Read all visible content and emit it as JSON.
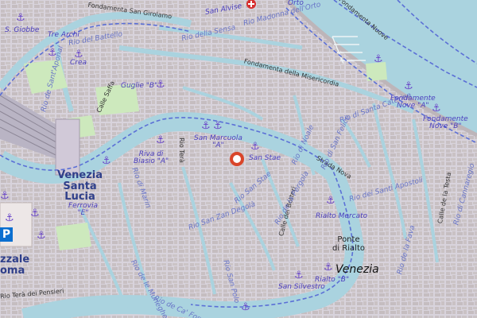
{
  "map": {
    "district": "Venezia",
    "poi": {
      "ponte_di_rialto": "Ponte\ndi Rialto"
    },
    "station": {
      "name": "Venezia\nSanta\nLucia",
      "sub": "Ferrovia\n\"E\""
    },
    "parking": {
      "symbol": "P",
      "name": "zzale\noma"
    },
    "streets": [
      "Fondamenta San Girolamo",
      "Fondamenta della Misericordia",
      "Fondamenta Nuove",
      "Calle Saffa",
      "Rio Terà",
      "Strada Nova",
      "Calle dei Botteri",
      "Calle de la Testa",
      "Rio Terà dei Pensieri",
      "Rio Terà"
    ],
    "canals": [
      "Rio del Battello",
      "Rio della Sensa",
      "Rio Madonna dell'Orto",
      "Rio di Santa Caterina",
      "Rio della Misericordia",
      "Rio di Noale",
      "Rio di San Felice",
      "Rio San Stae",
      "Rio di Marin",
      "Rio San Zan Degolà",
      "Rio de la Pergola",
      "Rio dei Santi Apostoli",
      "Rio de la Fava",
      "Rio del Gaffaro",
      "Rio de le Muneghe",
      "Rio de Ca' Foscari",
      "Rio San Polo",
      "Rio de Sant'Aponal",
      "Rio della Panada",
      "Rio di Cannaregio"
    ],
    "stops": [
      "S. Giobbe",
      "Tre Archi",
      "Crea",
      "Guglie \"B\"",
      "Fondamente\nNove \"A\"",
      "Fondamente\nNove \"B\"",
      "San Marcuola\n\"A\"",
      "San Stae",
      "Riva di\nBiasio \"A\"",
      "Rialto Mercato",
      "Rialto \"B\"",
      "San Silvestro",
      "San Alvise"
    ],
    "partial": [
      "Orto"
    ],
    "colors": {
      "water": "#aad3df",
      "land": "#ddd9e6",
      "buildings": "#c9c1c1",
      "park": "#cde9bd",
      "rail": "#b9b4c4",
      "ferry": "#5b6fd6",
      "anchor": "#6b48c9"
    }
  }
}
